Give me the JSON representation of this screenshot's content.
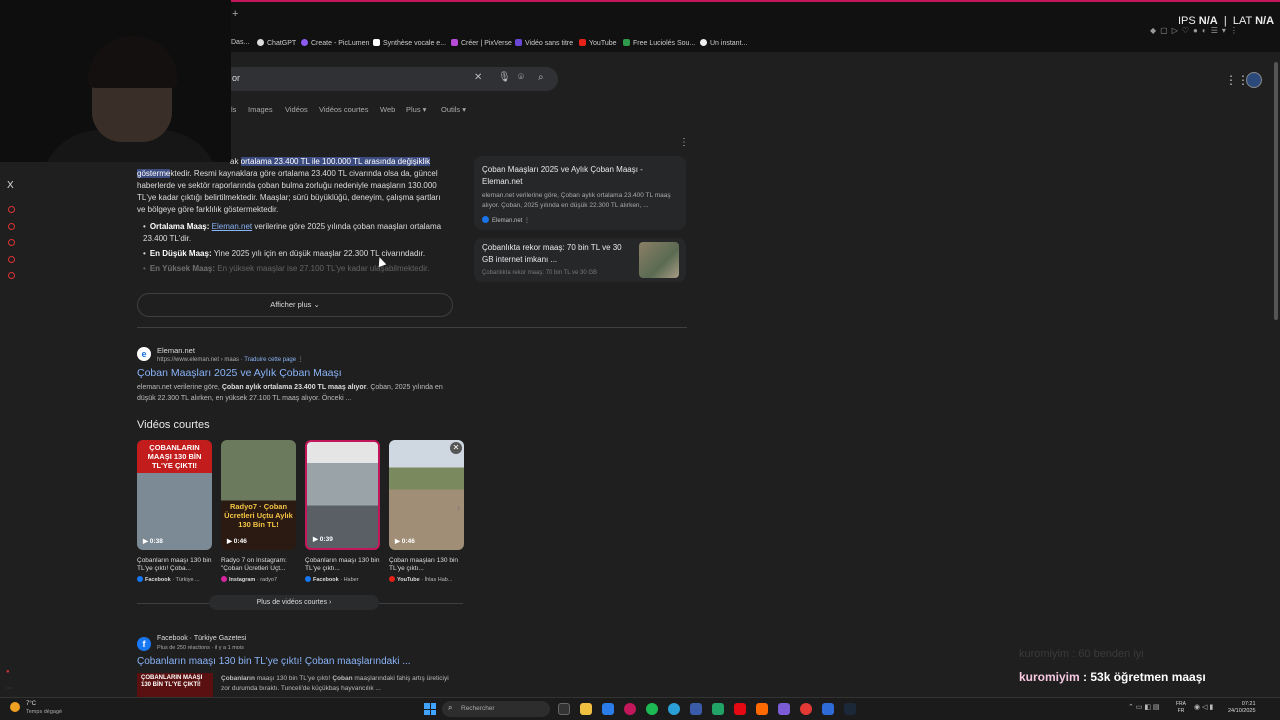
{
  "browser": {
    "new_tab": "+",
    "ips_label": "IPS",
    "ips_value": "N/A",
    "lat_label": "LAT",
    "lat_value": "N/A",
    "bookmarks": [
      "Das...",
      "ChatGPT",
      "Create - PicLumen",
      "Synthèse vocale e...",
      "Créer | PixVerse",
      "Vidéo sans titre",
      "YouTube",
      "Free Luciolés Sou...",
      "Un instant..."
    ]
  },
  "search": {
    "query": "or",
    "tabs": [
      "ls",
      "Images",
      "Vidéos",
      "Vidéos courtes",
      "Web",
      "Plus ▾",
      "Outils ▾"
    ]
  },
  "ai_overview": {
    "intro_prefix": "ak ",
    "highlight": "ortalama 23.400 TL ile 100.000 TL arasında değişiklik gösterme",
    "intro_rest": "ktedir. Resmi kaynaklara göre ortalama 23.400 TL civarında olsa da, güncel haberlerde ve sektör raporlarında çoban bulma zorluğu nedeniyle maaşların 130.000 TL'ye kadar çıktığı belirtilmektedir. Maaşlar; sürü büyüklüğü, deneyim, çalışma şartları ve bölgeye göre farklılık göstermektedir.",
    "bullet1_label": "Ortalama Maaş:",
    "bullet1_link": "Eleman.net",
    "bullet1_text": " verilerine göre 2025 yılında çoban maaşları ortalama 23.400 TL'dir.",
    "bullet2_label": "En Düşük Maaş:",
    "bullet2_text": " Yine 2025 yılı için en düşük maaşlar 22.300 TL civarındadır.",
    "bullet3_label": "En Yüksek Maaş:",
    "bullet3_text": " En yüksek maaşlar ise 27.100 TL'ye kadar ulaşabilmektedir.",
    "show_more": "Afficher plus",
    "card1_title": "Çoban Maaşları 2025 ve Aylık Çoban Maaşı - Eleman.net",
    "card1_snippet": "eleman.net verilerine göre, Çoban aylık ortalama 23.400 TL maaş alıyor. Çoban, 2025 yılında en düşük 22.300 TL alırken, ...",
    "card1_source": "Eleman.net",
    "card2_title": "Çobanlıkta rekor maaş: 70 bin TL ve 30 GB internet imkanı ...",
    "card2_source": "Çobanlıkta rekor maaş: 70 bin TL ve 30 GB"
  },
  "result1": {
    "site": "Eleman.net",
    "url": "https://www.eleman.net › maas",
    "translate": "Traduire cette page",
    "title": "Çoban Maaşları 2025 ve Aylık Çoban Maaşı",
    "snippet_a": "eleman.net verilerine göre, ",
    "snippet_b": "Çoban aylık ortalama 23.400 TL maaş alıyor",
    "snippet_c": ". Çoban, 2025 yılında en düşük 22.300 TL alırken, en yüksek 27.100 TL maaş alıyor. Önceki ..."
  },
  "videos": {
    "heading": "Vidéos courtes",
    "more": "Plus de vidéos courtes",
    "items": [
      {
        "caption": "ÇOBANLARIN MAAŞI 130 BİN TL'YE ÇIKTI!",
        "duration": "▶ 0:38",
        "title": "Çobanların maaşı 130 bin TL'ye çıktı! Çoba...",
        "platform": "Facebook",
        "channel": "Türkiye ..."
      },
      {
        "caption": "Radyo7 · Çoban Ücretleri Uçtu Aylık 130 Bin TL!",
        "duration": "▶ 0:46",
        "title": "Radyo 7 on Instagram: \"Çoban Ücretleri Uçt...",
        "platform": "Instagram",
        "channel": "radyo7"
      },
      {
        "caption": "",
        "duration": "▶ 0:39",
        "title": "Çobanların maaşı 130 bin TL'ye çıktı...",
        "platform": "Facebook",
        "channel": "Haber"
      },
      {
        "caption": "",
        "duration": "▶ 0:46",
        "title": "Çoban maaşları 130 bin TL'ye çıktı...",
        "platform": "YouTube",
        "channel": "İhlas Hab..."
      }
    ]
  },
  "result2": {
    "site": "Facebook · Türkiye Gazetesi",
    "sub": "Plus de 250 réactions · il y a 1 mois",
    "title": "Çobanların maaşı 130 bin TL'ye çıktı! Çoban maaşlarındaki ...",
    "thumb_caption": "ÇOBANLARIN MAAŞI 130 BİN TL'YE ÇIKTI!",
    "snippet_a": "Çobanların",
    "snippet_b": " maaşı 130 bin TL'ye çıktı! ",
    "snippet_c": "Çoban",
    "snippet_d": " maaşlarındaki fahiş artış üreticiyi zor durumda bıraktı. Tunceli'de küçükbaş hayvancılık ..."
  },
  "chat": {
    "faded": "kuromiyim : 60 benden iyi",
    "user": "kuromiyim",
    "message": " : 53k öğretmen maaşı"
  },
  "taskbar": {
    "temp": "7°C",
    "weather": "Temps dégagé",
    "search_placeholder": "Rechercher",
    "lang1": "FRA",
    "lang2": "FR",
    "time": "07:21",
    "date": "24/10/2025"
  },
  "colors": {
    "link": "#8ab4f8",
    "highlight": "#3d4c80",
    "accent": "#c2185b"
  }
}
